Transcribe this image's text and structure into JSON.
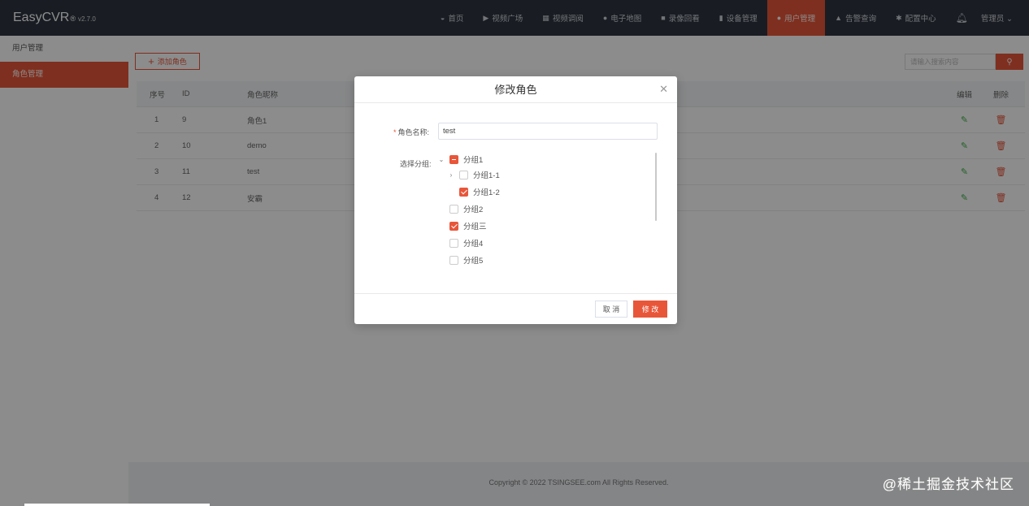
{
  "brand": {
    "name": "EasyCVR",
    "mark": "®",
    "version": "v2.7.0"
  },
  "nav": {
    "items": [
      {
        "label": "首页",
        "icon": "dashboard-icon"
      },
      {
        "label": "视频广场",
        "icon": "play-icon"
      },
      {
        "label": "视频调阅",
        "icon": "layout-icon"
      },
      {
        "label": "电子地图",
        "icon": "map-pin-icon"
      },
      {
        "label": "录像回看",
        "icon": "video-camera-icon"
      },
      {
        "label": "设备管理",
        "icon": "device-icon"
      },
      {
        "label": "用户管理",
        "icon": "user-icon",
        "active": true
      },
      {
        "label": "告警查询",
        "icon": "alarm-icon"
      },
      {
        "label": "配置中心",
        "icon": "gear-icon"
      }
    ],
    "user": "管理员 ⌄"
  },
  "sidebar": {
    "items": [
      {
        "label": "用户管理"
      },
      {
        "label": "角色管理",
        "active": true
      }
    ]
  },
  "toolbar": {
    "add_label": "添加角色",
    "search_placeholder": "请输入搜索内容"
  },
  "table": {
    "headers": {
      "no": "序号",
      "id": "ID",
      "name": "角色昵称",
      "edit": "编辑",
      "delete": "删除"
    },
    "rows": [
      {
        "no": "1",
        "id": "9",
        "name": "角色1"
      },
      {
        "no": "2",
        "id": "10",
        "name": "demo"
      },
      {
        "no": "3",
        "id": "11",
        "name": "test"
      },
      {
        "no": "4",
        "id": "12",
        "name": "安霸"
      }
    ]
  },
  "footer": "Copyright © 2022 TSINGSEE.com All Rights Reserved.",
  "watermark": "@稀土掘金技术社区",
  "modal": {
    "title": "修改角色",
    "name_label": "角色名称:",
    "name_value": "test",
    "group_label": "选择分组:",
    "tree": [
      {
        "label": "分组1",
        "state": "partial",
        "arrow": "⌄"
      },
      {
        "label": "分组1-1",
        "state": "unchecked",
        "arrow": "›"
      },
      {
        "label": "分组1-2",
        "state": "checked",
        "arrow": ""
      },
      {
        "label": "分组2",
        "state": "unchecked",
        "arrow": ""
      },
      {
        "label": "分组三",
        "state": "checked",
        "arrow": ""
      },
      {
        "label": "分组4",
        "state": "unchecked",
        "arrow": ""
      },
      {
        "label": "分组5",
        "state": "unchecked",
        "arrow": ""
      }
    ],
    "cancel_label": "取 消",
    "ok_label": "修 改"
  },
  "colors": {
    "accent": "#e8563a",
    "topbar": "#2f3540",
    "edit": "#3fae49"
  }
}
